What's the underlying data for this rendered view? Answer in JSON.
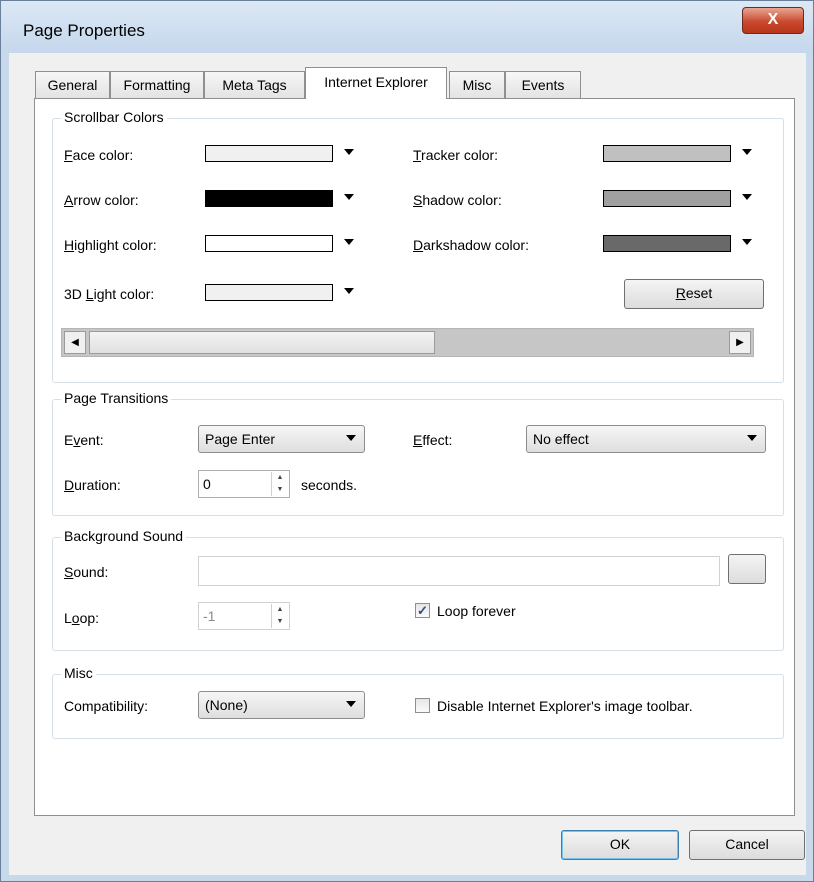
{
  "window": {
    "title": "Page Properties",
    "close_glyph": "X"
  },
  "tabs": [
    {
      "label": "General",
      "active": false
    },
    {
      "label": "Formatting",
      "active": false
    },
    {
      "label": "Meta Tags",
      "active": false
    },
    {
      "label": "Internet Explorer",
      "active": true
    },
    {
      "label": "Misc",
      "active": false
    },
    {
      "label": "Events",
      "active": false
    }
  ],
  "scrollbar_colors": {
    "title": "Scrollbar Colors",
    "face": {
      "key": "F",
      "rest": "ace color:",
      "color": "#f0f0f0"
    },
    "arrow": {
      "key": "A",
      "rest": "rrow color:",
      "color": "#000000"
    },
    "highlight": {
      "key": "H",
      "rest": "ighlight color:",
      "color": "#ffffff"
    },
    "light3d": {
      "pre": "3D ",
      "key": "L",
      "rest": "ight color:",
      "color": "#f0f0f0"
    },
    "tracker": {
      "key": "T",
      "rest": "racker color:",
      "color": "#c0c0c0"
    },
    "shadow": {
      "key": "S",
      "rest": "hadow color:",
      "color": "#a0a0a0"
    },
    "darkshadow": {
      "key": "D",
      "rest": "arkshadow color:",
      "color": "#696969"
    },
    "reset": {
      "key": "R",
      "rest": "eset"
    }
  },
  "page_transitions": {
    "title": "Page Transitions",
    "event": {
      "pre": "E",
      "key": "v",
      "rest": "ent:",
      "value": "Page Enter"
    },
    "effect": {
      "key": "E",
      "rest": "ffect:",
      "value": "No effect"
    },
    "duration": {
      "key": "D",
      "rest": "uration:",
      "value": "0",
      "unit": "seconds."
    }
  },
  "background_sound": {
    "title": "Background Sound",
    "sound": {
      "key": "S",
      "rest": "ound:",
      "value": ""
    },
    "loop": {
      "pre": "L",
      "key": "o",
      "rest": "op:",
      "value": "-1"
    },
    "loop_forever": {
      "label": "Loop forever",
      "checked": true,
      "glyph": "✓"
    }
  },
  "misc": {
    "title": "Misc",
    "compatibility": {
      "label": "Compatibility:",
      "value": "(None)"
    },
    "disable_toolbar": {
      "label": "Disable Internet Explorer's image toolbar.",
      "checked": false
    }
  },
  "footer": {
    "ok": "OK",
    "cancel": "Cancel"
  },
  "icons": {
    "left_arrow": "◀",
    "right_arrow": "▶",
    "spin_up": "▲",
    "spin_down": "▼"
  }
}
